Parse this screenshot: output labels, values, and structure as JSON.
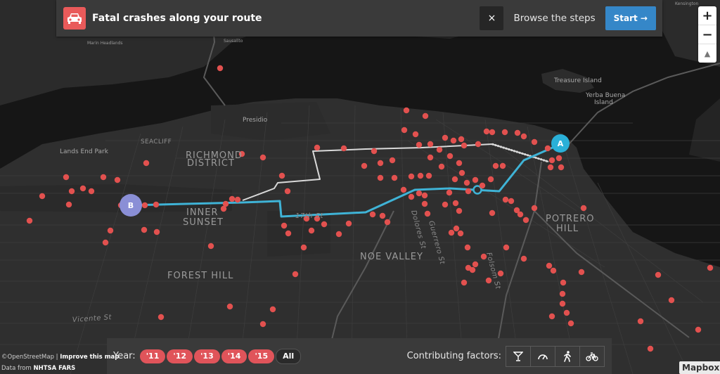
{
  "header": {
    "title": "Fatal crashes along your route",
    "close_label": "×",
    "browse_label": "Browse the steps",
    "start_label": "Start →"
  },
  "zoom": {
    "in": "+",
    "out": "−",
    "north": "▲"
  },
  "filters": {
    "year_label": "Year:",
    "years": [
      "'11",
      "'12",
      "'13",
      "'14",
      "'15",
      "All"
    ],
    "factors_label": "Contributing factors:",
    "factors": [
      "cocktail-icon",
      "speedometer-icon",
      "pedestrian-icon",
      "bicycle-icon"
    ]
  },
  "route": {
    "start_marker": "A",
    "end_marker": "B"
  },
  "map_labels": {
    "neighborhoods": [
      "RICHMOND",
      "DISTRICT",
      "INNER",
      "SUNSET",
      "FOREST HILL",
      "NOE VALLEY",
      "POTRERO",
      "HILL",
      "SEACLIFF"
    ],
    "places": [
      "Presidio",
      "Lands End Park",
      "Treasure Island",
      "Yerba Buena",
      "Island",
      "Sausalito",
      "Marin Headlands",
      "Kensington"
    ],
    "streets": [
      "Vicente St",
      "Dolores St",
      "Guerrero St",
      "Folsom St",
      "17th St"
    ]
  },
  "attribution": {
    "osm": "©OpenStreetMap",
    "improve": "Improve this map",
    "data_prefix": "Data from",
    "data_source": "NHTSA FARS",
    "logo": "Mapbox"
  },
  "colors": {
    "crash": "#e2514f",
    "route_active": "#3fb3d6",
    "route_alt": "#d9d9d9",
    "marker_a": "#2ab0d8",
    "marker_b": "#8a8fd6",
    "start_button": "#3587c8"
  }
}
